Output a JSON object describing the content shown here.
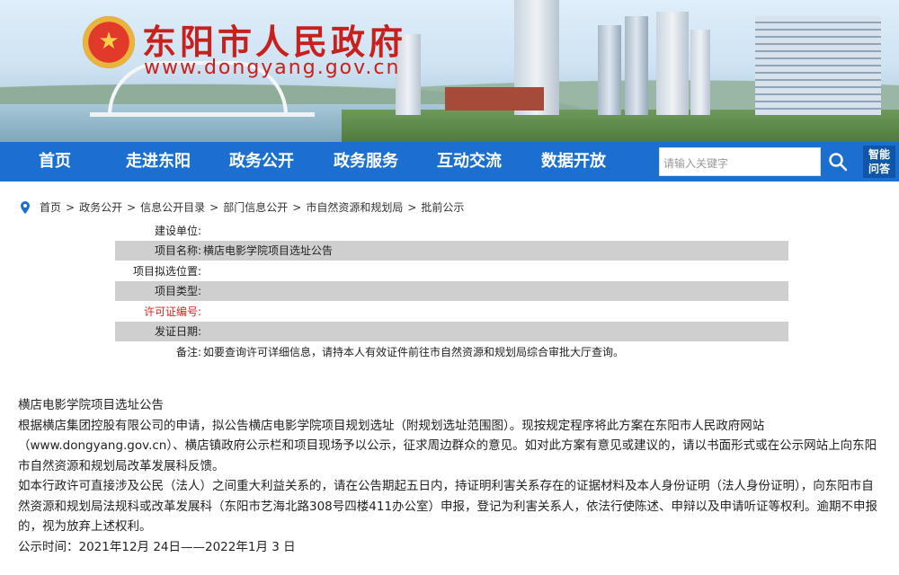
{
  "header": {
    "site_title": "东阳市人民政府",
    "site_url": "www.dongyang.gov.cn"
  },
  "nav": {
    "items": [
      "首页",
      "走进东阳",
      "政务公开",
      "政务服务",
      "互动交流",
      "数据开放"
    ],
    "search_placeholder": "请输入关键字",
    "assistant_label_1": "智能",
    "assistant_label_2": "问答"
  },
  "breadcrumb": [
    "首页",
    "政务公开",
    "信息公开目录",
    "部门信息公开",
    "市自然资源和规划局",
    "批前公示"
  ],
  "info_table": [
    {
      "label": "建设单位:",
      "value": ""
    },
    {
      "label": "项目名称:",
      "value": "横店电影学院项目选址公告"
    },
    {
      "label": "项目拟选位置:",
      "value": ""
    },
    {
      "label": "项目类型:",
      "value": ""
    },
    {
      "label": "许可证编号:",
      "value": ""
    },
    {
      "label": "发证日期:",
      "value": ""
    },
    {
      "label": "备注:",
      "value": "如要查询许可详细信息，请持本人有效证件前往市自然资源和规划局综合审批大厅查询。"
    }
  ],
  "article": {
    "title": "横店电影学院项目选址公告",
    "para1": "根据横店集团控股有限公司的申请，拟公告横店电影学院项目规划选址（附规划选址范围图）。现按规定程序将此方案在东阳市人民政府网站（www.dongyang.gov.cn）、横店镇政府公示栏和项目现场予以公示，征求周边群众的意见。如对此方案有意见或建议的，请以书面形式或在公示网站上向东阳市自然资源和规划局改革发展科反馈。",
    "para2": "如本行政许可直接涉及公民（法人）之间重大利益关系的，请在公告期起五日内，持证明利害关系存在的证据材料及本人身份证明（法人身份证明），向东阳市自然资源和规划局法规科或改革发展科（东阳市艺海北路308号四楼411办公室）申报，登记为利害关系人，依法行使陈述、申辩以及申请听证等权利。逾期不申报的，视为放弃上述权利。",
    "period": "公示时间：2021年12月 24日——2022年1月 3  日"
  },
  "colors": {
    "nav_bg": "#1a6fd0",
    "title_red": "#c8201c",
    "row_shade": "#cfcfcf",
    "highlight_red": "#d9261c"
  }
}
